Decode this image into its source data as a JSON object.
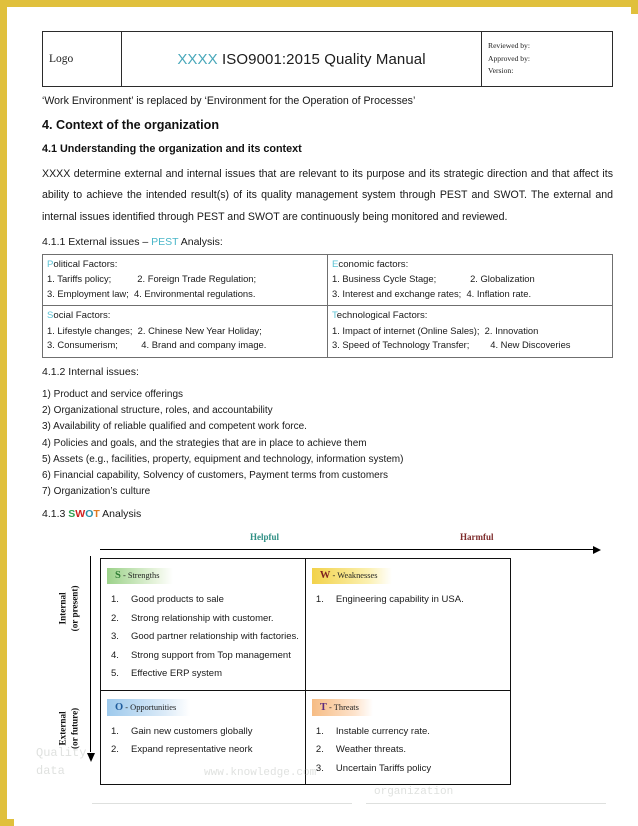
{
  "header": {
    "logo_label": "Logo",
    "title_prefix": "XXXX",
    "title_main": " ISO9001:2015 Quality Manual",
    "meta": {
      "reviewed_by": "Reviewed by:",
      "approved_by": "Approved by:",
      "version": "Version:"
    }
  },
  "body": {
    "note": "‘Work Environment’ is replaced by ‘Environment for the Operation of Processes’",
    "section_title": "4. Context of the organization",
    "subsection_title": "4.1 Understanding the organization and its context",
    "paragraph": "XXXX determine external and internal issues that are relevant to its purpose and its strategic direction and that affect its ability to achieve the intended result(s) of its quality management system through PEST and SWOT. The external and internal issues identified through PEST and SWOT are continuously being monitored and reviewed.",
    "external_issues_label_pre": "4.1.1 External issues – ",
    "external_issues_label_accent": "PEST",
    "external_issues_label_post": " Analysis:",
    "internal_issues_label": "4.1.2 Internal issues:",
    "swot_label_pre": "4.1.3 ",
    "swot_label_post": " Analysis"
  },
  "pest": {
    "political": {
      "cap": "P",
      "rest": "olitical Factors:",
      "rows": [
        "1. Tariffs policy;          2. Foreign Trade Regulation;",
        "3. Employment law;  4. Environmental regulations."
      ]
    },
    "economic": {
      "cap": "E",
      "rest": "conomic factors:",
      "rows": [
        "1. Business Cycle Stage;             2. Globalization",
        "3. Interest and exchange rates;  4. Inflation rate."
      ]
    },
    "social": {
      "cap": "S",
      "rest": "ocial Factors:",
      "rows": [
        "1. Lifestyle changes;  2. Chinese New Year Holiday;",
        "3. Consumerism;         4. Brand and company image."
      ]
    },
    "technological": {
      "cap": "T",
      "rest": "echnological Factors:",
      "rows": [
        "1. Impact of internet (Online Sales);  2. Innovation",
        "3. Speed of Technology Transfer;        4. New Discoveries"
      ]
    }
  },
  "internal_issues": [
    "1) Product and service offerings",
    "2) Organizational structure, roles, and accountability",
    "3) Availability of reliable qualified and competent work force.",
    "4) Policies and goals, and the strategies that are in place to achieve them",
    "5) Assets (e.g., facilities, property, equipment and technology, information system)",
    "6) Financial capability, Solvency of customers, Payment terms from customers",
    "7) Organization’s culture"
  ],
  "swot_title_letters": [
    {
      "ch": "S",
      "color": "#2e9e4f"
    },
    {
      "ch": "W",
      "color": "#d02020"
    },
    {
      "ch": "O",
      "color": "#2a8fa8"
    },
    {
      "ch": "T",
      "color": "#e07a20"
    }
  ],
  "swot": {
    "axis": {
      "helpful": "Helpful",
      "harmful": "Harmful",
      "internal_line1": "Internal",
      "internal_line2": "(or present)",
      "external_line1": "External",
      "external_line2": "(or future)"
    },
    "quadrants": [
      {
        "key": "strengths",
        "letter": "S",
        "label": " - Strengths",
        "items": [
          "Good products to sale",
          "Strong relationship with customer.",
          "Good partner relationship with factories.",
          "Strong support from Top management",
          "Effective ERP system"
        ]
      },
      {
        "key": "weaknesses",
        "letter": "W",
        "label": " - Weaknesses",
        "items": [
          "Engineering capability in USA."
        ]
      },
      {
        "key": "opportunities",
        "letter": "O",
        "label": " - Opportunities",
        "items": [
          "Gain new customers globally",
          "Expand representative neork"
        ]
      },
      {
        "key": "threats",
        "letter": "T",
        "label": " - Threats",
        "items": [
          "Instable currency rate.",
          "Weather threats.",
          "Uncertain Tariffs policy"
        ]
      }
    ]
  },
  "watermarks": {
    "line1": "Quality",
    "line2": "data",
    "line3": "www.knowledge.com",
    "line4": "organization"
  },
  "colors": {
    "page_border": "#e0c03c",
    "accent_teal": "#49a8ba",
    "helpful": "#2f8f84",
    "harmful": "#7d2b2b"
  }
}
